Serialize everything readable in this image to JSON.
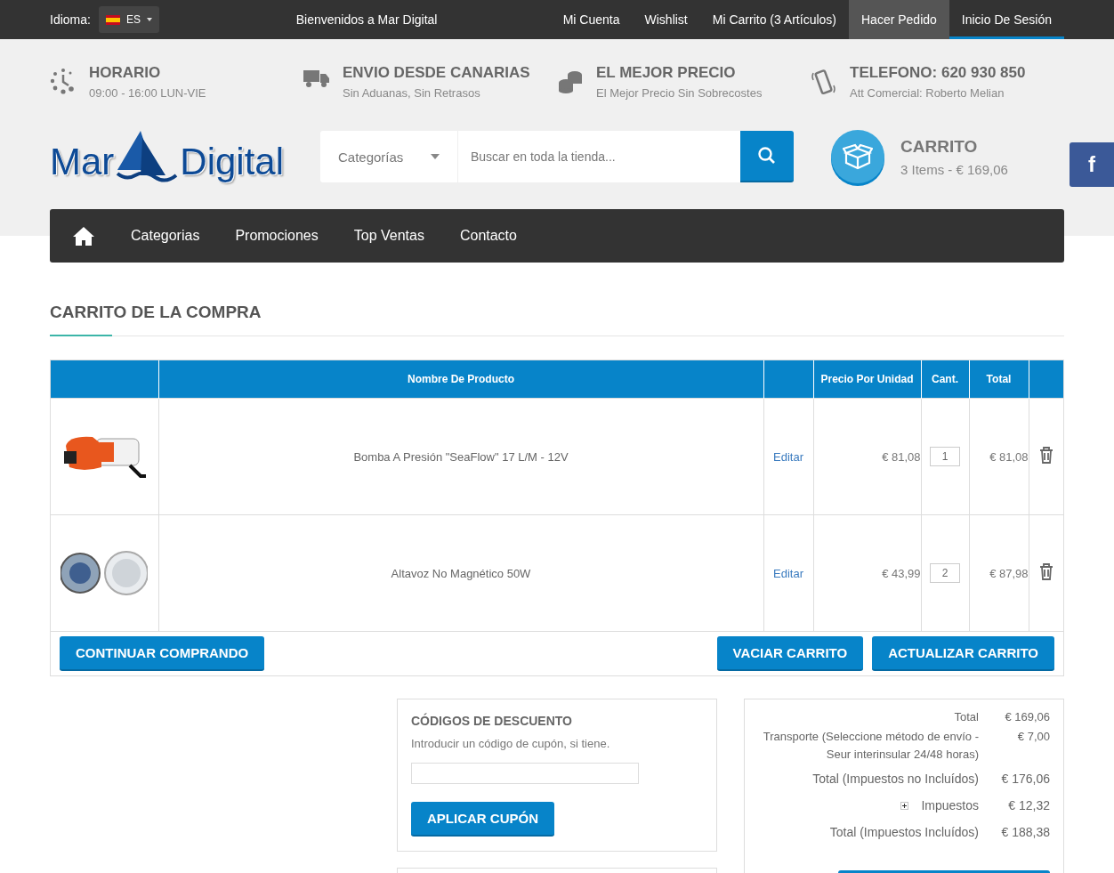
{
  "topbar": {
    "language_label": "Idioma:",
    "language": "ES",
    "welcome": "Bienvenidos a Mar Digital",
    "links": [
      {
        "label": "Mi Cuenta",
        "kind": "plain"
      },
      {
        "label": "Wishlist",
        "kind": "plain"
      },
      {
        "label": "Mi Carrito (3 Artículos)",
        "kind": "plain"
      },
      {
        "label": "Hacer Pedido",
        "kind": "highlighted"
      },
      {
        "label": "Inicio De Sesión",
        "kind": "underlined"
      }
    ]
  },
  "features": [
    {
      "kind": "clock",
      "title": "HORARIO",
      "subtitle": "09:00 - 16:00 LUN-VIE"
    },
    {
      "kind": "truck",
      "title": "ENVIO DESDE CANARIAS",
      "subtitle": "Sin Aduanas, Sin Retrasos"
    },
    {
      "kind": "coins",
      "title": "EL MEJOR PRECIO",
      "subtitle": "El Mejor Precio Sin Sobrecostes"
    },
    {
      "kind": "phone",
      "title": "TELEFONO: 620 930 850",
      "subtitle": "Att Comercial: Roberto Melian"
    }
  ],
  "logo": {
    "left": "Mar",
    "right": "Digital"
  },
  "search": {
    "category": "Categorías",
    "placeholder": "Buscar en toda la tienda..."
  },
  "cart": {
    "title": "CARRITO",
    "summary": "3 Items - € 169,06"
  },
  "social": {
    "label": "f"
  },
  "nav": [
    "Categorias",
    "Promociones",
    "Top Ventas",
    "Contacto"
  ],
  "page_title": "CARRITO DE LA COMPRA",
  "table": {
    "columns": {
      "product": "Nombre De Producto",
      "price": "Precio Por Unidad",
      "qty": "Cant.",
      "total": "Total"
    },
    "rows": [
      {
        "kind": "pump",
        "name": "Bomba A Presión \"SeaFlow\" 17 L/M - 12V",
        "edit": "Editar",
        "price": "€ 81,08",
        "qty": "1",
        "total": "€ 81,08"
      },
      {
        "kind": "speaker",
        "name": "Altavoz No Magnético 50W",
        "edit": "Editar",
        "price": "€ 43,99",
        "qty": "2",
        "total": "€ 87,98"
      }
    ]
  },
  "actions": {
    "continue": "CONTINUAR COMPRANDO",
    "clear": "VACIAR CARRITO",
    "update": "ACTUALIZAR CARRITO"
  },
  "coupon": {
    "title": "CÓDIGOS DE DESCUENTO",
    "hint": "Introducir un código de cupón, si tiene.",
    "button": "APLICAR CUPÓN"
  },
  "totals": [
    {
      "kind": "line",
      "label": "Total",
      "value": "€ 169,06"
    },
    {
      "kind": "line",
      "label": "Transporte (Seleccione método de envío - Seur interinsular 24/48 horas)",
      "value": "€ 7,00"
    },
    {
      "kind": "total",
      "label": "Total (Impuestos no Incluídos)",
      "value": "€ 176,06"
    },
    {
      "kind": "expandable",
      "label": "Impuestos",
      "value": "€ 12,32"
    },
    {
      "kind": "total",
      "label": "Total (Impuestos Incluídos)",
      "value": "€ 188,38"
    }
  ]
}
